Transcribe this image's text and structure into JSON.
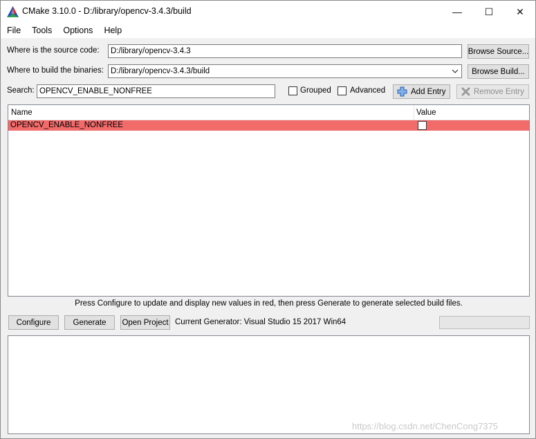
{
  "window": {
    "title": "CMake 3.10.0 - D:/library/opencv-3.4.3/build",
    "minimize_glyph": "—",
    "maximize_glyph": "☐",
    "close_glyph": "✕"
  },
  "menu": {
    "items": [
      {
        "label": "File"
      },
      {
        "label": "Tools"
      },
      {
        "label": "Options"
      },
      {
        "label": "Help"
      }
    ]
  },
  "source": {
    "label": "Where is the source code:",
    "value": "D:/library/opencv-3.4.3",
    "button": "Browse Source..."
  },
  "binaries": {
    "label": "Where to build the binaries:",
    "value": "D:/library/opencv-3.4.3/build",
    "button": "Browse Build..."
  },
  "search": {
    "label": "Search:",
    "value": "OPENCV_ENABLE_NONFREE",
    "grouped_label": "Grouped",
    "grouped_checked": false,
    "advanced_label": "Advanced",
    "advanced_checked": false,
    "add_entry": "Add Entry",
    "remove_entry": "Remove Entry"
  },
  "table": {
    "columns": [
      "Name",
      "Value"
    ],
    "rows": [
      {
        "name": "OPENCV_ENABLE_NONFREE",
        "value_checked": false,
        "highlight_color": "#f26b6b"
      }
    ]
  },
  "hint": "Press Configure to update and display new values in red, then press Generate to generate selected build files.",
  "actions": {
    "configure": "Configure",
    "generate": "Generate",
    "open_project": "Open Project",
    "generator": "Current Generator: Visual Studio 15 2017 Win64"
  },
  "watermark": "https://blog.csdn.net/ChenCong7375"
}
